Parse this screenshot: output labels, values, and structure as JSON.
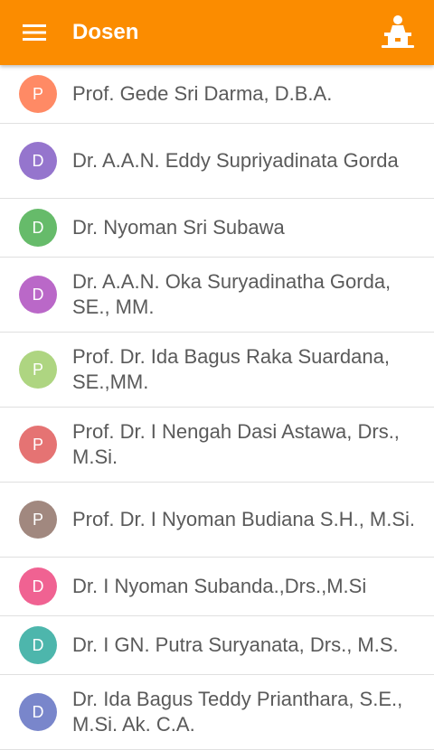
{
  "appbar": {
    "title": "Dosen",
    "color": "#fb8c00",
    "left_icon": "hamburger-menu-icon",
    "right_icon": "presenter-icon"
  },
  "lecturers": [
    {
      "initial": "P",
      "name": "Prof. Gede Sri Darma, D.B.A.",
      "color": "#ff8a65"
    },
    {
      "initial": "D",
      "name": "Dr. A.A.N. Eddy Supriyadinata Gorda",
      "color": "#9575cd"
    },
    {
      "initial": "D",
      "name": "Dr. Nyoman Sri Subawa",
      "color": "#66bb6a"
    },
    {
      "initial": "D",
      "name": "Dr. A.A.N. Oka Suryadinatha Gorda, SE., MM.",
      "color": "#ba68c8"
    },
    {
      "initial": "P",
      "name": "Prof. Dr. Ida Bagus Raka Suardana, SE.,MM.",
      "color": "#aed581"
    },
    {
      "initial": "P",
      "name": "Prof. Dr. I Nengah Dasi Astawa, Drs., M.Si.",
      "color": "#e57373"
    },
    {
      "initial": "P",
      "name": "Prof. Dr. I Nyoman Budiana S.H., M.Si.",
      "color": "#a1887f"
    },
    {
      "initial": "D",
      "name": "Dr. I Nyoman Subanda.,Drs.,M.Si",
      "color": "#f06292"
    },
    {
      "initial": "D",
      "name": "Dr. I GN. Putra Suryanata, Drs., M.S.",
      "color": "#4db6ac"
    },
    {
      "initial": "D",
      "name": "Dr. Ida Bagus Teddy Prianthara, S.E., M.Si. Ak. C.A.",
      "color": "#7986cb"
    }
  ]
}
